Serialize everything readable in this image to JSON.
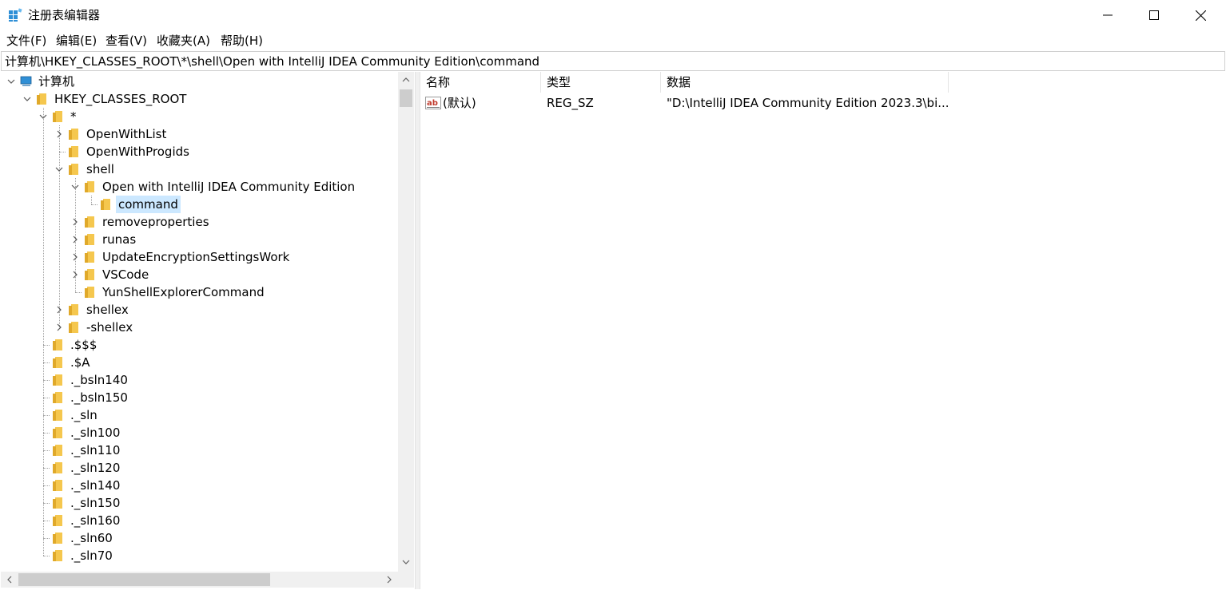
{
  "window": {
    "title": "注册表编辑器",
    "icon": "regedit-icon",
    "controls": [
      "minimize-icon",
      "maximize-icon",
      "close-icon"
    ]
  },
  "menu": {
    "file": "文件(F)",
    "edit": "编辑(E)",
    "view": "查看(V)",
    "favorites": "收藏夹(A)",
    "help": "帮助(H)"
  },
  "address": "计算机\\HKEY_CLASSES_ROOT\\*\\shell\\Open with IntelliJ IDEA Community Edition\\command",
  "tree": [
    {
      "label": "计算机",
      "depth": 0,
      "state": "expanded",
      "icon": "computer-icon"
    },
    {
      "label": "HKEY_CLASSES_ROOT",
      "depth": 1,
      "state": "expanded",
      "icon": "folder-icon"
    },
    {
      "label": "*",
      "depth": 2,
      "state": "expanded",
      "icon": "folder-icon"
    },
    {
      "label": "OpenWithList",
      "depth": 3,
      "state": "collapsed",
      "icon": "folder-icon"
    },
    {
      "label": "OpenWithProgids",
      "depth": 3,
      "state": "leaf",
      "icon": "folder-icon"
    },
    {
      "label": "shell",
      "depth": 3,
      "state": "expanded",
      "icon": "folder-icon"
    },
    {
      "label": "Open with IntelliJ IDEA Community Edition",
      "depth": 4,
      "state": "expanded",
      "icon": "folder-icon"
    },
    {
      "label": "command",
      "depth": 5,
      "state": "leaf",
      "icon": "folder-icon",
      "selected": true
    },
    {
      "label": "removeproperties",
      "depth": 4,
      "state": "collapsed",
      "icon": "folder-icon"
    },
    {
      "label": "runas",
      "depth": 4,
      "state": "collapsed",
      "icon": "folder-icon"
    },
    {
      "label": "UpdateEncryptionSettingsWork",
      "depth": 4,
      "state": "collapsed",
      "icon": "folder-icon"
    },
    {
      "label": "VSCode",
      "depth": 4,
      "state": "collapsed",
      "icon": "folder-icon"
    },
    {
      "label": "YunShellExplorerCommand",
      "depth": 4,
      "state": "leaf",
      "icon": "folder-icon"
    },
    {
      "label": "shellex",
      "depth": 3,
      "state": "collapsed",
      "icon": "folder-icon"
    },
    {
      "label": "-shellex",
      "depth": 3,
      "state": "collapsed",
      "icon": "folder-icon"
    },
    {
      "label": ".$$$",
      "depth": 2,
      "state": "leaf",
      "icon": "folder-icon"
    },
    {
      "label": ".$A",
      "depth": 2,
      "state": "leaf",
      "icon": "folder-icon"
    },
    {
      "label": "._bsln140",
      "depth": 2,
      "state": "leaf",
      "icon": "folder-icon"
    },
    {
      "label": "._bsln150",
      "depth": 2,
      "state": "leaf",
      "icon": "folder-icon"
    },
    {
      "label": "._sln",
      "depth": 2,
      "state": "leaf",
      "icon": "folder-icon"
    },
    {
      "label": "._sln100",
      "depth": 2,
      "state": "leaf",
      "icon": "folder-icon"
    },
    {
      "label": "._sln110",
      "depth": 2,
      "state": "leaf",
      "icon": "folder-icon"
    },
    {
      "label": "._sln120",
      "depth": 2,
      "state": "leaf",
      "icon": "folder-icon"
    },
    {
      "label": "._sln140",
      "depth": 2,
      "state": "leaf",
      "icon": "folder-icon"
    },
    {
      "label": "._sln150",
      "depth": 2,
      "state": "leaf",
      "icon": "folder-icon"
    },
    {
      "label": "._sln160",
      "depth": 2,
      "state": "leaf",
      "icon": "folder-icon"
    },
    {
      "label": "._sln60",
      "depth": 2,
      "state": "leaf",
      "icon": "folder-icon"
    },
    {
      "label": "._sln70",
      "depth": 2,
      "state": "leaf",
      "icon": "folder-icon"
    }
  ],
  "values": {
    "columns": {
      "name": "名称",
      "type": "类型",
      "data": "数据"
    },
    "rows": [
      {
        "name": "(默认)",
        "type": "REG_SZ",
        "data": "\"D:\\IntelliJ IDEA Community Edition 2023.3\\bi...",
        "icon": "reg-string-icon"
      }
    ]
  },
  "colors": {
    "selection": "#cce8ff",
    "folder": "#f5c74e",
    "computer": "#2f8fd6",
    "scrollbar_track": "#f0f0f0",
    "scrollbar_thumb": "#cdcdcd"
  }
}
